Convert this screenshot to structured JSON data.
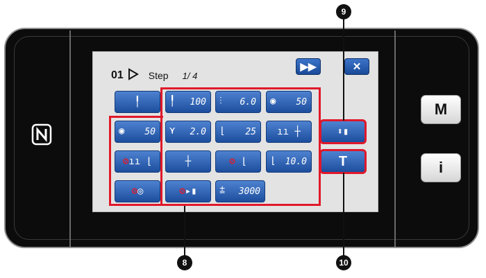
{
  "panel": {
    "left_icon": "nfc-icon",
    "side_buttons": [
      {
        "label": "M"
      },
      {
        "label": "i"
      }
    ]
  },
  "screen": {
    "header": {
      "step_number": "01",
      "step_label": "Step",
      "step_count": "1/ 4"
    },
    "top_buttons": [
      {
        "label": "▶▶",
        "icon": "fast-forward-icon"
      },
      {
        "label": "✕",
        "icon": "close-icon"
      }
    ],
    "rows": [
      [
        {
          "icon": "needle-icon",
          "value": ""
        },
        {
          "icon": "needle-stitch-icon",
          "value": "100"
        },
        {
          "icon": "stitch-length-icon",
          "value": "6.0"
        },
        {
          "icon": "tension-r-icon",
          "value": "50"
        }
      ],
      [
        {
          "icon": "tension-l-icon",
          "value": "50"
        },
        {
          "icon": "thread-icon",
          "value": "2.0"
        },
        {
          "icon": "presser-foot-icon",
          "value": "25"
        },
        {
          "icon": "pause-needle-icon",
          "value": ""
        },
        {
          "icon": "foot-lift-icon",
          "value": ""
        }
      ],
      [
        {
          "icon": "no-pause-foot-icon",
          "value": ""
        },
        {
          "icon": "needle-up-down-icon",
          "value": ""
        },
        {
          "icon": "no-thread-trim-foot-icon",
          "value": ""
        },
        {
          "icon": "foot-pressure-icon",
          "value": "10.0"
        },
        {
          "icon": "T",
          "value": "T"
        }
      ],
      [
        {
          "icon": "no-winder-icon",
          "value": ""
        },
        {
          "icon": "no-wiper-icon",
          "value": ""
        },
        {
          "icon": "speed-icon",
          "value": "3000"
        }
      ]
    ]
  },
  "callouts": {
    "c8": "8",
    "c9": "9",
    "c10": "10"
  }
}
